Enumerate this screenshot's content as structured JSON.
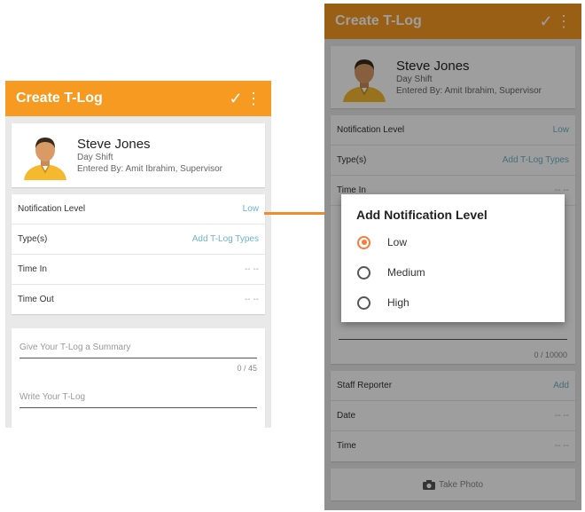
{
  "app": {
    "title": "Create T-Log",
    "accent": "#f79a22"
  },
  "profile": {
    "name": "Steve Jones",
    "shift": "Day Shift",
    "entered_by": "Entered By: Amit Ibrahim, Supervisor"
  },
  "details": {
    "notification_label": "Notification Level",
    "notification_value": "Low",
    "types_label": "Type(s)",
    "types_value": "Add T-Log Types",
    "time_in_label": "Time In",
    "time_in_value": "-- --",
    "time_out_label": "Time Out",
    "time_out_value": "-- --"
  },
  "summary": {
    "placeholder": "Give Your T-Log a Summary",
    "counter": "0 / 45"
  },
  "log": {
    "placeholder": "Write Your T-Log",
    "counter": "0 / 10000"
  },
  "staff": {
    "reporter_label": "Staff Reporter",
    "reporter_value": "Add",
    "date_label": "Date",
    "date_value": "-- --",
    "time_label": "Time",
    "time_value": "-- --"
  },
  "photo": {
    "label": "Take Photo",
    "icon": "camera-icon"
  },
  "dialog": {
    "title": "Add Notification Level",
    "options": [
      {
        "label": "Low",
        "selected": true
      },
      {
        "label": "Medium",
        "selected": false
      },
      {
        "label": "High",
        "selected": false
      }
    ]
  }
}
